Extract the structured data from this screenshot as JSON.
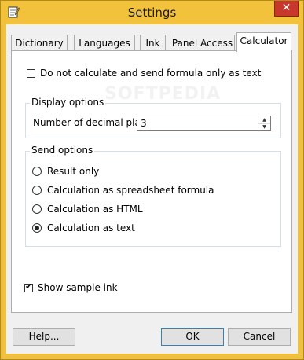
{
  "window": {
    "title": "Settings",
    "close_glyph": "✕",
    "accent": "#f2c23c",
    "close_color": "#c8372b"
  },
  "tabs": [
    {
      "label": "Dictionary",
      "active": false
    },
    {
      "label": "Languages",
      "active": false
    },
    {
      "label": "Ink",
      "active": false
    },
    {
      "label": "Panel Access",
      "active": false
    },
    {
      "label": "Calculator",
      "active": true
    }
  ],
  "calculator": {
    "no_calc_label": "Do not calculate and send formula only as text",
    "no_calc_checked": false,
    "display_options": {
      "title": "Display options",
      "decimal_label": "Number of decimal places:",
      "decimal_value": "3"
    },
    "send_options": {
      "title": "Send options",
      "options": [
        {
          "label": "Result only",
          "selected": false
        },
        {
          "label": "Calculation as spreadsheet formula",
          "selected": false
        },
        {
          "label": "Calculation as HTML",
          "selected": false
        },
        {
          "label": "Calculation as text",
          "selected": true
        }
      ]
    },
    "show_sample_label": "Show sample ink",
    "show_sample_checked": true
  },
  "buttons": {
    "help": "Help...",
    "ok": "OK",
    "cancel": "Cancel"
  },
  "watermark": "SOFTPEDIA"
}
